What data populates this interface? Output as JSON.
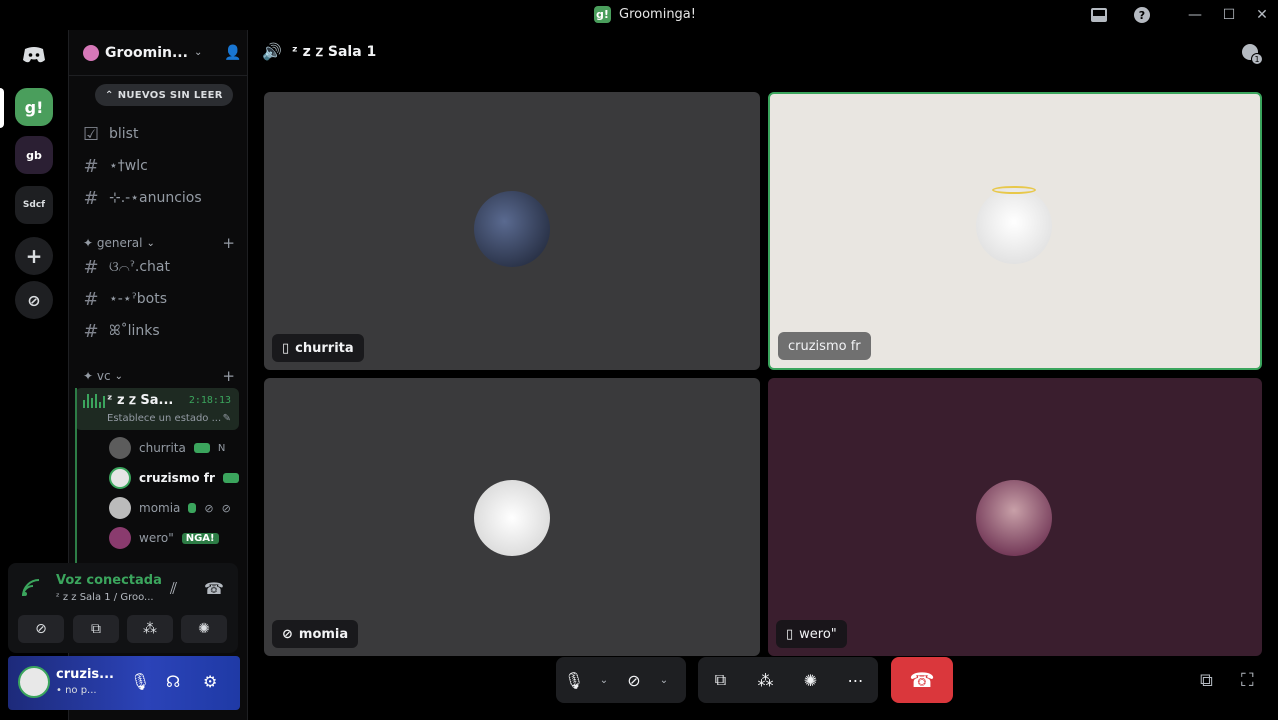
{
  "window": {
    "title": "Groominga!",
    "logo_text": "g!"
  },
  "rail": {
    "servers": [
      {
        "text": "g!",
        "color": "#4a9e5c"
      },
      {
        "text": "gb",
        "color": "#3a2b4a"
      },
      {
        "text": "Sdcf",
        "color": "#2b2d31"
      }
    ],
    "add_server": "+",
    "discover": "⊘"
  },
  "sidebar": {
    "guild_name": "Groomin...",
    "new_unread": "NUEVOS SIN LEER",
    "top_channels": [
      {
        "icon": "☑",
        "name": "blist"
      },
      {
        "icon": "#",
        "name": "⋆†wlc"
      },
      {
        "icon": "#",
        "name": "⊹.-⋆anuncios"
      }
    ],
    "categories": {
      "general": "✦ general",
      "vc": "✦ vc"
    },
    "general_channels": [
      {
        "icon": "#",
        "name": "ଓ⌒ˀ.chat"
      },
      {
        "icon": "#",
        "name": "⋆-⋆ˀbots"
      },
      {
        "icon": "#",
        "name": "ꕤ˚links"
      }
    ],
    "voice_channel": {
      "name": "ᶻ z 𝗓 Sa...",
      "time": "2:18:13",
      "status": "Establece un estado ..."
    },
    "members": [
      {
        "name": "churrita",
        "tag": "N",
        "color": "#5c5c5c"
      },
      {
        "name": "cruzismo fr",
        "tag": "",
        "color": "#e5e5e5"
      },
      {
        "name": "momia",
        "tag": "",
        "color": "#bbbbbb"
      },
      {
        "name": "wero\"",
        "tag": "NGA!",
        "color": "#8a3b6e"
      }
    ]
  },
  "voice_panel": {
    "status": "Voz conectada",
    "sub": "ᶻ z 𝗓 Sala 1 / Groo..."
  },
  "user_panel": {
    "name": "cruzis...",
    "sub": "• no p..."
  },
  "main": {
    "channel_title": "ᶻ z 𝗓 Sala 1",
    "thread_badge": "1",
    "tiles": [
      {
        "name": "churrita",
        "bg": "#3a3a3c",
        "av": "#2a3550"
      },
      {
        "name": "cruzismo fr",
        "bg": "#e9e6e1",
        "av": "#f2f2f2"
      },
      {
        "name": "momia",
        "bg": "#3a3a3c",
        "av": "#f0f0f0"
      },
      {
        "name": "wero\"",
        "bg": "#3a1e2e",
        "av": "#5a2a4a"
      }
    ]
  },
  "colors": {
    "accent_green": "#3ba55d",
    "hangup_red": "#da373c"
  }
}
